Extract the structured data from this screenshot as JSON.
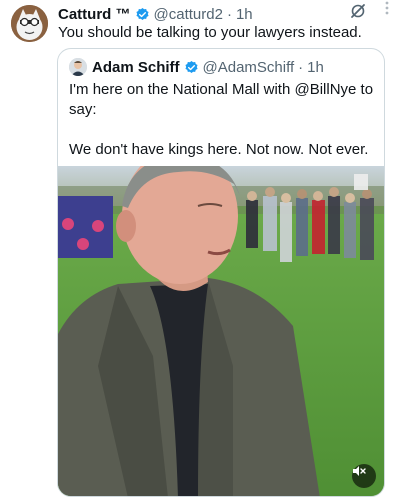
{
  "tweet": {
    "author": "Catturd ™",
    "handle": "@catturd2",
    "separator": "·",
    "time": "1h",
    "text": "You should be talking to your lawyers instead."
  },
  "quoted": {
    "author": "Adam Schiff",
    "handle": "@AdamSchiff",
    "separator": "·",
    "time": "1h",
    "line1": "I'm here on the National Mall with @BillNye to say:",
    "line2": "We don't have kings here. Not now. Not ever."
  },
  "colors": {
    "verified": "#1d9bf0",
    "text": "#0f1419",
    "secondary": "#536471",
    "border": "#cfd9de"
  },
  "icons": {
    "verified": "verified-badge-icon",
    "grok": "grok-icon",
    "more": "more-icon",
    "mute": "volume-muted-icon"
  }
}
